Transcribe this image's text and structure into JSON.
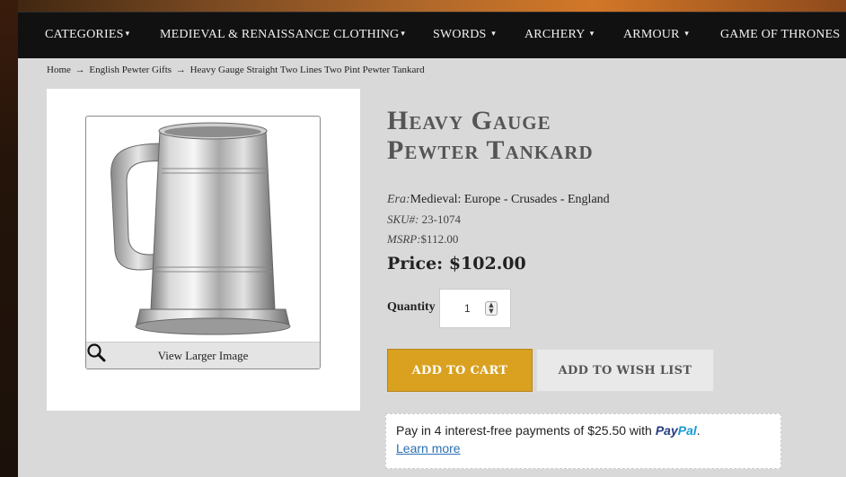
{
  "nav": {
    "items": [
      {
        "label": "CATEGORIES",
        "caret": "▾"
      },
      {
        "label": "MEDIEVAL & RENAISSANCE CLOTHING",
        "caret": "▾"
      },
      {
        "label": "SWORDS",
        "caret": "▾"
      },
      {
        "label": "ARCHERY",
        "caret": "▾"
      },
      {
        "label": "ARMOUR",
        "caret": "▾"
      },
      {
        "label": "GAME OF THRONES",
        "caret": ""
      }
    ]
  },
  "breadcrumb": {
    "home": "Home",
    "sep": "→",
    "category": "English Pewter Gifts",
    "current": "Heavy Gauge Straight Two Lines Two Pint Pewter Tankard"
  },
  "product": {
    "title_line1": "Heavy Gauge",
    "title_line2": "Pewter Tankard",
    "view_larger": "View Larger Image",
    "era_label": "Era:",
    "era_value": "Medieval: Europe - Crusades - England",
    "sku_label": "SKU#:",
    "sku_value": " 23-1074",
    "msrp_label": "MSRP:",
    "msrp_value": "$112.00",
    "price_label": "Price:",
    "price_value": "$102.00",
    "quantity_label": "Quantity",
    "quantity_value": "1"
  },
  "actions": {
    "add_to_cart": "ADD TO CART",
    "add_to_wish_list": "ADD TO WISH LIST"
  },
  "paypal": {
    "message": "Pay in 4 interest-free payments of $25.50 with",
    "logo_pay": "Pay",
    "logo_pal": "Pal",
    "period": ".",
    "learn_more": "Learn more"
  },
  "colors": {
    "add_to_cart_bg": "#d9a11f",
    "navbar_bg": "#111111",
    "content_bg": "#d9d9d9"
  }
}
